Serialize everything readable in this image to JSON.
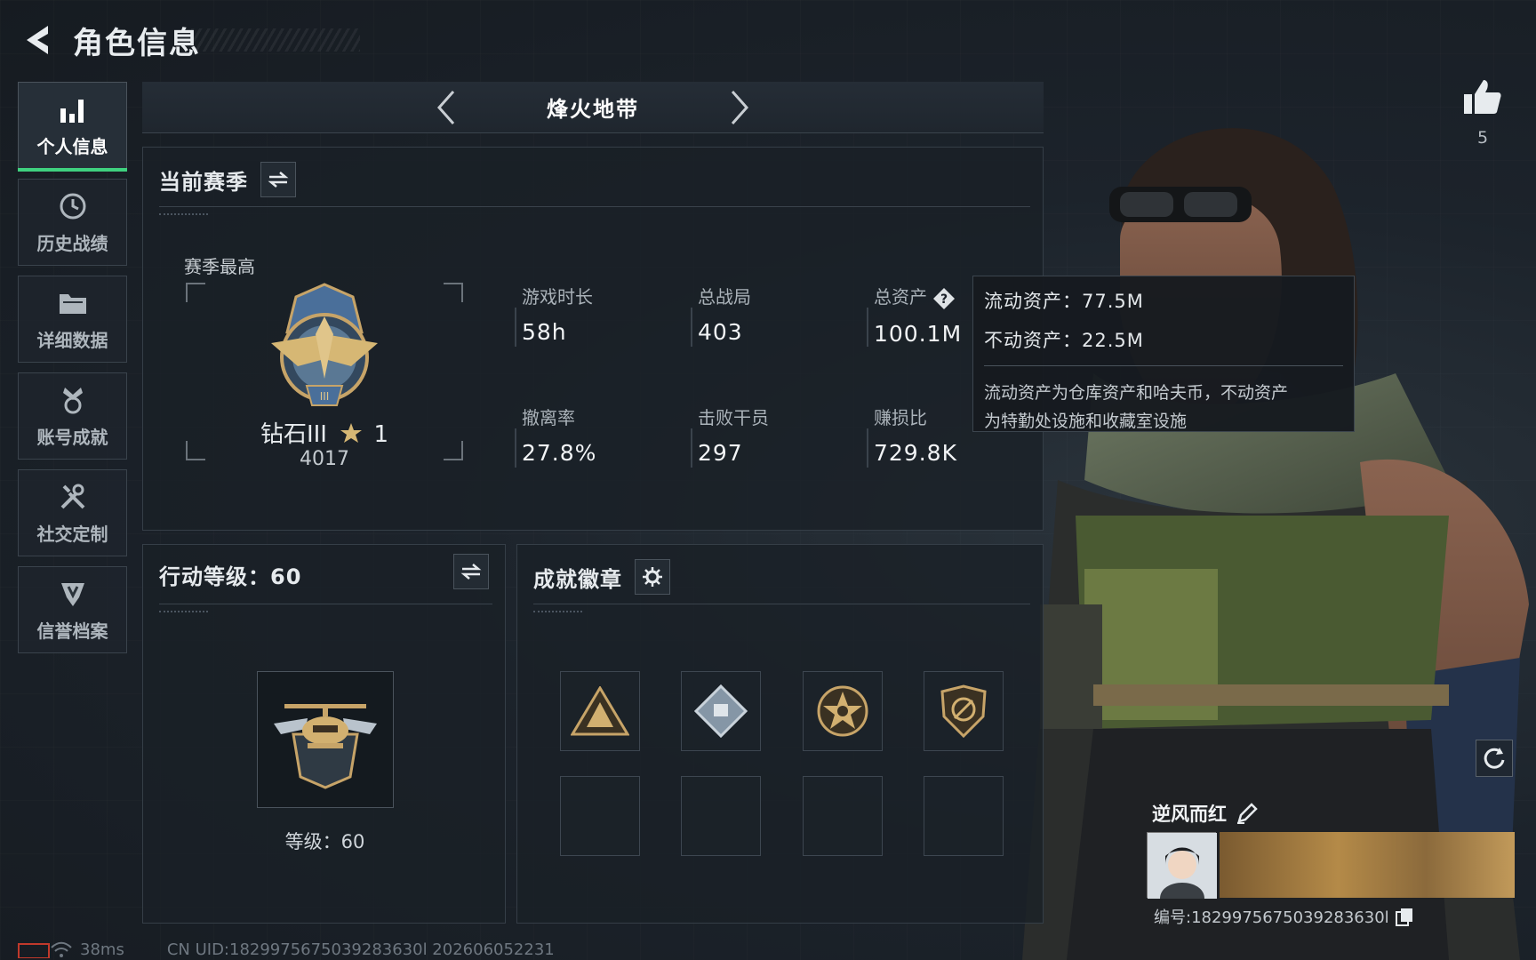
{
  "header": {
    "title": "角色信息"
  },
  "sidebar": {
    "items": [
      {
        "label": "个人信息",
        "icon": "bar-chart-icon",
        "active": true
      },
      {
        "label": "历史战绩",
        "icon": "clock-icon",
        "active": false
      },
      {
        "label": "详细数据",
        "icon": "folder-icon",
        "active": false
      },
      {
        "label": "账号成就",
        "icon": "medal-icon",
        "active": false
      },
      {
        "label": "社交定制",
        "icon": "tools-icon",
        "active": false
      },
      {
        "label": "信誉档案",
        "icon": "shield-icon",
        "active": false
      }
    ]
  },
  "mode": {
    "title": "烽火地带"
  },
  "season": {
    "title": "当前赛季",
    "best_label": "赛季最高",
    "rank_name": "钻石III",
    "rank_stars": "1",
    "rank_score": "4017",
    "stats": [
      {
        "label": "游戏时长",
        "value": "58h"
      },
      {
        "label": "总战局",
        "value": "403"
      },
      {
        "label": "总资产",
        "value": "100.1M"
      },
      {
        "label": "撤离率",
        "value": "27.8%"
      },
      {
        "label": "击败干员",
        "value": "297"
      },
      {
        "label": "赚损比",
        "value": "729.8K"
      }
    ]
  },
  "tooltip": {
    "liquid": "流动资产：77.5M",
    "fixed": "不动资产：22.5M",
    "desc_line1": "流动资产为仓库资产和哈夫币，不动资产",
    "desc_line2": "为特勤处设施和收藏室设施"
  },
  "level": {
    "title": "行动等级：60",
    "text": "等级：60"
  },
  "badges": {
    "title": "成就徽章"
  },
  "profile": {
    "likes": "5",
    "name": "逆风而红",
    "id": "编号:1829975675039283630l"
  },
  "footer": {
    "ping": "38ms",
    "uid": "CN UID:1829975675039283630l 202606052231"
  },
  "colors": {
    "accent": "#3fd17f",
    "background": "#1a2028"
  }
}
